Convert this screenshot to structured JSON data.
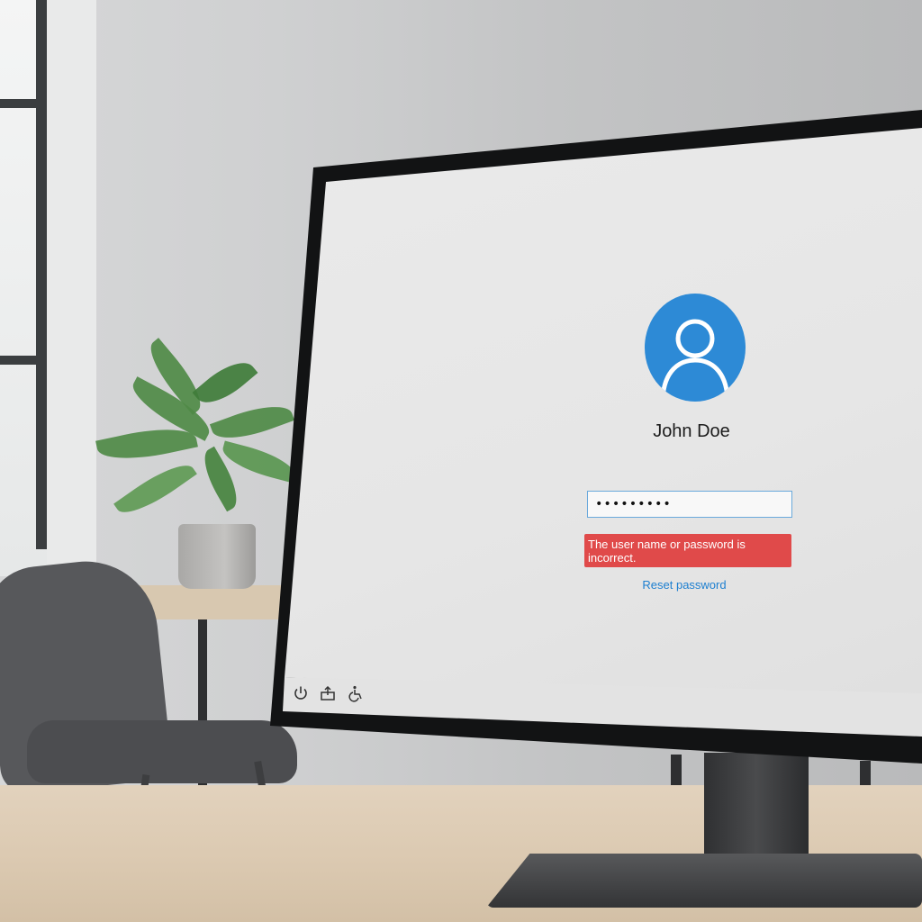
{
  "login": {
    "user_name": "John Doe",
    "password_value": "•••••••••",
    "error_message": "The user name or password is incorrect.",
    "reset_link": "Reset password"
  },
  "taskbar": {
    "icons": [
      "power-icon",
      "network-icon",
      "accessibility-icon"
    ]
  },
  "colors": {
    "avatar": "#2d8ad6",
    "error": "#e04a4a",
    "link": "#1d7fd0",
    "field_border": "#6aa9dc"
  }
}
